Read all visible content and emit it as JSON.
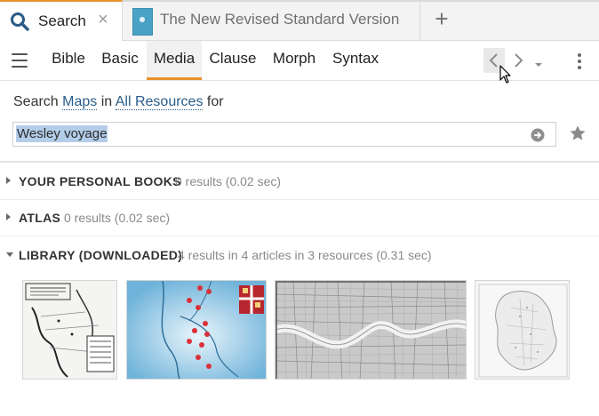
{
  "tabs": {
    "search_label": "Search",
    "close_glyph": "×",
    "bible_label": "The New Revised Standard Version",
    "add_glyph": "+"
  },
  "search_types": [
    "Bible",
    "Basic",
    "Media",
    "Clause",
    "Morph",
    "Syntax"
  ],
  "query": {
    "prefix": "Search",
    "media_type": "Maps",
    "in_word": "in",
    "resources": "All Resources",
    "for_word": "for",
    "value": "Wesley voyage"
  },
  "sections": {
    "personal": {
      "title": "YOUR PERSONAL BOOKS",
      "meta": "0 results (0.02 sec)"
    },
    "atlas": {
      "title": "ATLAS",
      "meta": "0 results (0.02 sec)"
    },
    "library": {
      "title": "LIBRARY (DOWNLOADED)",
      "meta": "4 results in 4 articles in 3 resources (0.31 sec)"
    }
  },
  "colors": {
    "accent": "#e8912b",
    "link": "#2a5d8a",
    "selection": "#b3cde9"
  },
  "icons": [
    "search-icon",
    "close-icon",
    "bible-thumbnail",
    "plus-icon",
    "menu-icon",
    "chevron-left-icon",
    "chevron-right-icon",
    "caret-down-icon",
    "more-vertical-icon",
    "go-arrow-icon",
    "star-icon"
  ]
}
